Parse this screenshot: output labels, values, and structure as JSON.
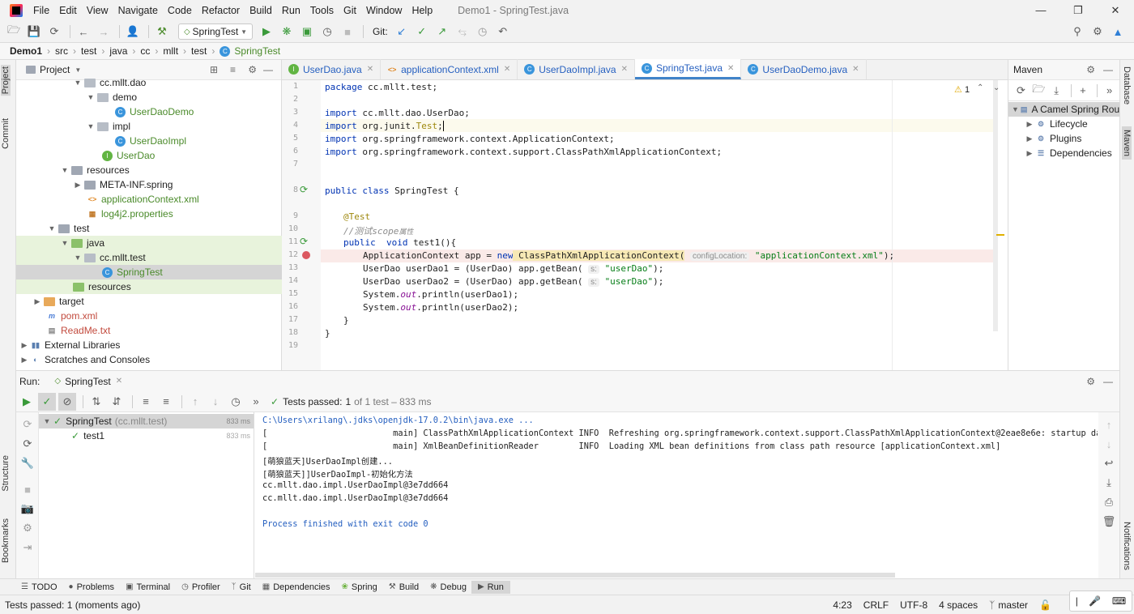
{
  "menu": [
    "File",
    "Edit",
    "View",
    "Navigate",
    "Code",
    "Refactor",
    "Build",
    "Run",
    "Tools",
    "Git",
    "Window",
    "Help"
  ],
  "window_title": "Demo1 - SpringTest.java",
  "toolbar": {
    "run_config": "SpringTest",
    "git_label": "Git:"
  },
  "breadcrumb": [
    "Demo1",
    "src",
    "test",
    "java",
    "cc",
    "mllt",
    "test",
    "SpringTest"
  ],
  "project_panel": {
    "title": "Project"
  },
  "left_strip": {
    "project": "Project",
    "commit": "Commit",
    "structure": "Structure",
    "bookmarks": "Bookmarks"
  },
  "right_strip": {
    "database": "Database",
    "maven": "Maven",
    "notifications": "Notifications"
  },
  "tree": [
    {
      "label": "cc.mllt.dao",
      "type": "package",
      "color": "#1f1f1f"
    },
    {
      "label": "demo",
      "type": "package",
      "color": "#1f1f1f"
    },
    {
      "label": "UserDaoDemo",
      "type": "class",
      "color": "#4a8a2a"
    },
    {
      "label": "impl",
      "type": "package",
      "color": "#1f1f1f"
    },
    {
      "label": "UserDaoImpl",
      "type": "class",
      "color": "#4a8a2a"
    },
    {
      "label": "UserDao",
      "type": "interface",
      "color": "#4a8a2a"
    },
    {
      "label": "resources",
      "type": "folder",
      "color": "#1f1f1f"
    },
    {
      "label": "META-INF.spring",
      "type": "folder",
      "color": "#1f1f1f"
    },
    {
      "label": "applicationContext.xml",
      "type": "xml",
      "color": "#4a8a2a"
    },
    {
      "label": "log4j2.properties",
      "type": "props",
      "color": "#4a8a2a"
    },
    {
      "label": "test",
      "type": "folder",
      "color": "#1f1f1f"
    },
    {
      "label": "java",
      "type": "folder",
      "color": "#1f1f1f"
    },
    {
      "label": "cc.mllt.test",
      "type": "package",
      "color": "#1f1f1f"
    },
    {
      "label": "SpringTest",
      "type": "class",
      "color": "#4a8a2a"
    },
    {
      "label": "resources",
      "type": "folder",
      "color": "#1f1f1f"
    },
    {
      "label": "target",
      "type": "folder",
      "color": "#1f1f1f"
    },
    {
      "label": "pom.xml",
      "type": "maven",
      "color": "#c24a3d"
    },
    {
      "label": "ReadMe.txt",
      "type": "text",
      "color": "#c24a3d"
    },
    {
      "label": "External Libraries",
      "type": "lib",
      "color": "#1f1f1f"
    },
    {
      "label": "Scratches and Consoles",
      "type": "scratch",
      "color": "#1f1f1f"
    }
  ],
  "tabs": [
    "UserDao.java",
    "applicationContext.xml",
    "UserDaoImpl.java",
    "SpringTest.java",
    "UserDaoDemo.java"
  ],
  "editor": {
    "warning_count": "1",
    "line_numbers": [
      "1",
      "2",
      "3",
      "4",
      "5",
      "6",
      "7",
      "8",
      "9",
      "10",
      "11",
      "12",
      "13",
      "14",
      "15",
      "16",
      "17",
      "18",
      "19"
    ],
    "code": {
      "l1a": "package",
      "l1b": " cc.mllt.test;",
      "l3a": "import",
      "l3b": " cc.mllt.dao.UserDao;",
      "l4a": "import",
      "l4b": " org.junit.",
      "l4c": "Test",
      "l4d": ";",
      "l5a": "import",
      "l5b": " org.springframework.context.ApplicationContext;",
      "l6a": "import",
      "l6b": " org.springframework.context.support.ClassPathXmlApplicationContext;",
      "l8a": "public class",
      "l8b": " SpringTest {",
      "l9": "@Test",
      "l10a": "//测试",
      "l10b": "scope",
      "l10c": "属性",
      "l11a": "public  void",
      "l11b": " test1(){",
      "l12a": "ApplicationContext app = ",
      "l12b": "new",
      "l12c": " ClassPathXmlApplicationContext(",
      "l12hint": "configLocation:",
      "l12d": "\"applicationContext.xml\"",
      "l12e": ");",
      "l13a": "UserDao userDao1 = (UserDao) app.getBean(",
      "l13hint": "s:",
      "l13b": "\"userDao\"",
      "l13c": ");",
      "l14a": "UserDao userDao2 = (UserDao) app.getBean(",
      "l14hint": "s:",
      "l14b": "\"userDao\"",
      "l14c": ");",
      "l15a": "System.",
      "l15b": "out",
      "l15c": ".println(userDao1);",
      "l16a": "System.",
      "l16b": "out",
      "l16c": ".println(userDao2);",
      "l17": "}",
      "l18": "}"
    }
  },
  "maven": {
    "title": "Maven",
    "project": "A Camel Spring Rou",
    "items": [
      "Lifecycle",
      "Plugins",
      "Dependencies"
    ]
  },
  "run_panel": {
    "label": "Run:",
    "tab": "SpringTest",
    "status_prefix": "Tests passed:",
    "status_count": "1",
    "status_rest": "of 1 test – 833 ms",
    "tree": [
      {
        "label": "SpringTest",
        "sub": "(cc.mllt.test)",
        "time": "833 ms"
      },
      {
        "label": "test1",
        "sub": "",
        "time": "833 ms"
      }
    ],
    "console": [
      "C:\\Users\\xrilang\\.jdks\\openjdk-17.0.2\\bin\\java.exe ...",
      "[                         main] ClassPathXmlApplicationContext INFO  Refreshing org.springframework.context.support.ClassPathXmlApplicationContext@2eae8e6e: startup date [Tue Ma",
      "[                         main] XmlBeanDefinitionReader        INFO  Loading XML bean definitions from class path resource [applicationContext.xml]",
      "[萌狼蓝天]UserDaoImpl创建...",
      "[萌狼蓝天]]UserDaoImpl-初始化方法",
      "cc.mllt.dao.impl.UserDaoImpl@3e7dd664",
      "cc.mllt.dao.impl.UserDaoImpl@3e7dd664",
      "",
      "Process finished with exit code 0"
    ]
  },
  "tool_windows": [
    "TODO",
    "Problems",
    "Terminal",
    "Profiler",
    "Git",
    "Dependencies",
    "Spring",
    "Build",
    "Debug",
    "Run"
  ],
  "status_bar": {
    "message": "Tests passed: 1 (moments ago)",
    "position": "4:23",
    "line_sep": "CRLF",
    "encoding": "UTF-8",
    "indent": "4 spaces",
    "branch": "master"
  }
}
